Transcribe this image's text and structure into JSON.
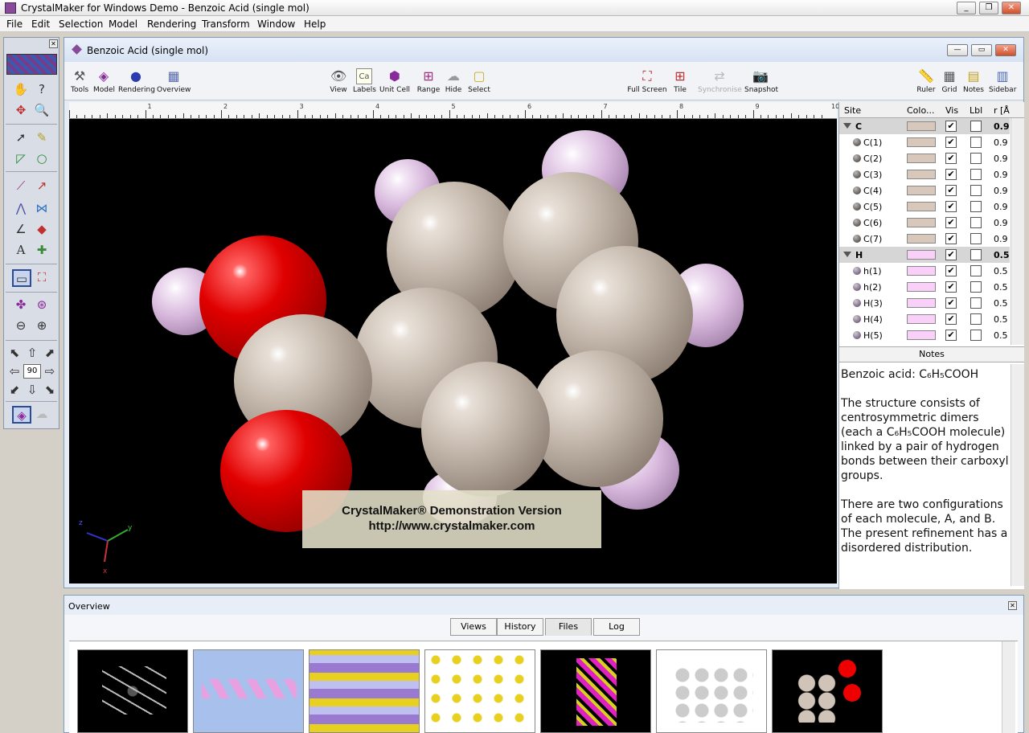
{
  "app": {
    "title": "CrystalMaker for Windows Demo - Benzoic Acid (single mol)",
    "window_buttons": [
      "minimize-icon",
      "restore-icon",
      "close-icon"
    ]
  },
  "menu": [
    "File",
    "Edit",
    "Selection",
    "Model",
    "Rendering",
    "Transform",
    "Window",
    "Help"
  ],
  "palette": {
    "rotation_step": "90"
  },
  "document": {
    "title": "Benzoic Acid (single mol)",
    "toolbar": {
      "tools": "Tools",
      "model": "Model",
      "rendering": "Rendering",
      "overview": "Overview",
      "view": "View",
      "labels": "Labels",
      "labels_icon_text": "Ca",
      "unit_cell": "Unit Cell",
      "range": "Range",
      "hide": "Hide",
      "select": "Select",
      "full_screen": "Full Screen",
      "tile": "Tile",
      "synchronise": "Synchronise",
      "snapshot": "Snapshot",
      "ruler": "Ruler",
      "grid": "Grid",
      "notes": "Notes",
      "sidebar": "Sidebar"
    },
    "ruler_marks": [
      "1",
      "2",
      "3",
      "4",
      "5",
      "6",
      "7",
      "8",
      "9",
      "10"
    ],
    "demo_banner": {
      "line1": "CrystalMaker® Demonstration Version",
      "line2": "http://www.crystalmaker.com"
    },
    "axes": {
      "x": "x",
      "y": "y",
      "z": "z"
    },
    "colors": {
      "carbon": "#d8c8bc",
      "hydrogen": "#f8d0f8",
      "oxygen": "#e00000",
      "background": "#000000"
    }
  },
  "sidebar": {
    "headers": {
      "site": "Site",
      "color": "Colo...",
      "vis": "Vis",
      "lbl": "Lbl",
      "r": "r [Å"
    },
    "groups": [
      {
        "name": "C",
        "r": "0.9",
        "sites": [
          {
            "name": "C(1)",
            "r": "0.9"
          },
          {
            "name": "C(2)",
            "r": "0.9"
          },
          {
            "name": "C(3)",
            "r": "0.9"
          },
          {
            "name": "C(4)",
            "r": "0.9"
          },
          {
            "name": "C(5)",
            "r": "0.9"
          },
          {
            "name": "C(6)",
            "r": "0.9"
          },
          {
            "name": "C(7)",
            "r": "0.9"
          }
        ]
      },
      {
        "name": "H",
        "r": "0.5",
        "sites": [
          {
            "name": "h(1)",
            "r": "0.5"
          },
          {
            "name": "h(2)",
            "r": "0.5"
          },
          {
            "name": "H(3)",
            "r": "0.5"
          },
          {
            "name": "H(4)",
            "r": "0.5"
          },
          {
            "name": "H(5)",
            "r": "0.5"
          }
        ]
      }
    ],
    "notes_header": "Notes",
    "notes": [
      "Benzoic acid: C₆H₅COOH",
      "The structure consists of centrosymmetric dimers (each a C₆H₅COOH molecule) linked by a pair of hydrogen bonds between their carboxyl groups.",
      "There are two configurations of each molecule, A, and B. The present refinement has a disordered distribution."
    ]
  },
  "overview": {
    "title": "Overview",
    "tabs": [
      "Views",
      "History",
      "Files",
      "Log"
    ],
    "active_tab": "Files"
  }
}
